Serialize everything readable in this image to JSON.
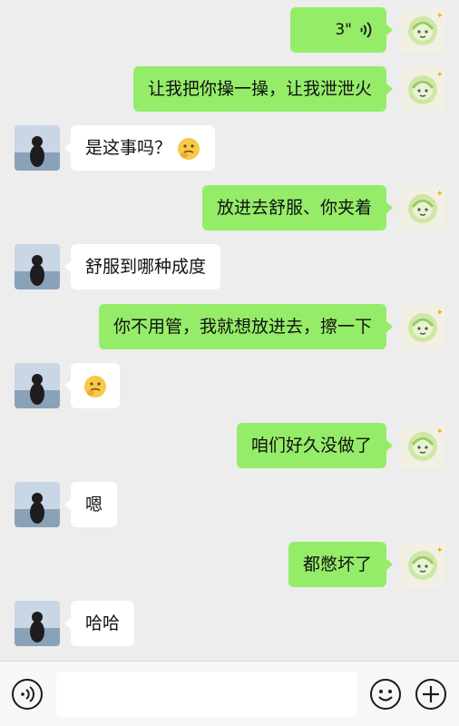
{
  "messages": [
    {
      "side": "out",
      "type": "voice",
      "duration": "3\""
    },
    {
      "side": "out",
      "type": "text",
      "text": "让我把你操一操，让我泄泄火"
    },
    {
      "side": "in",
      "type": "text",
      "text": "是这事吗？",
      "emoji": "thinking-face-emoji"
    },
    {
      "side": "out",
      "type": "text",
      "text": "放进去舒服、你夹着"
    },
    {
      "side": "in",
      "type": "text",
      "text": "舒服到哪种成度"
    },
    {
      "side": "out",
      "type": "text",
      "text": "你不用管，我就想放进去，擦一下"
    },
    {
      "side": "in",
      "type": "emoji",
      "emoji": "thinking-face-emoji"
    },
    {
      "side": "out",
      "type": "text",
      "text": "咱们好久没做了"
    },
    {
      "side": "in",
      "type": "text",
      "text": "嗯"
    },
    {
      "side": "out",
      "type": "text",
      "text": "都憋坏了"
    },
    {
      "side": "in",
      "type": "text",
      "text": "哈哈"
    }
  ],
  "input_bar": {
    "left_icon": "voice-mode-icon",
    "right_icons": [
      "emoji-icon",
      "plus-icon"
    ],
    "input_value": ""
  },
  "colors": {
    "background": "#ededed",
    "outgoing_bubble": "#95ec69",
    "incoming_bubble": "#ffffff"
  }
}
